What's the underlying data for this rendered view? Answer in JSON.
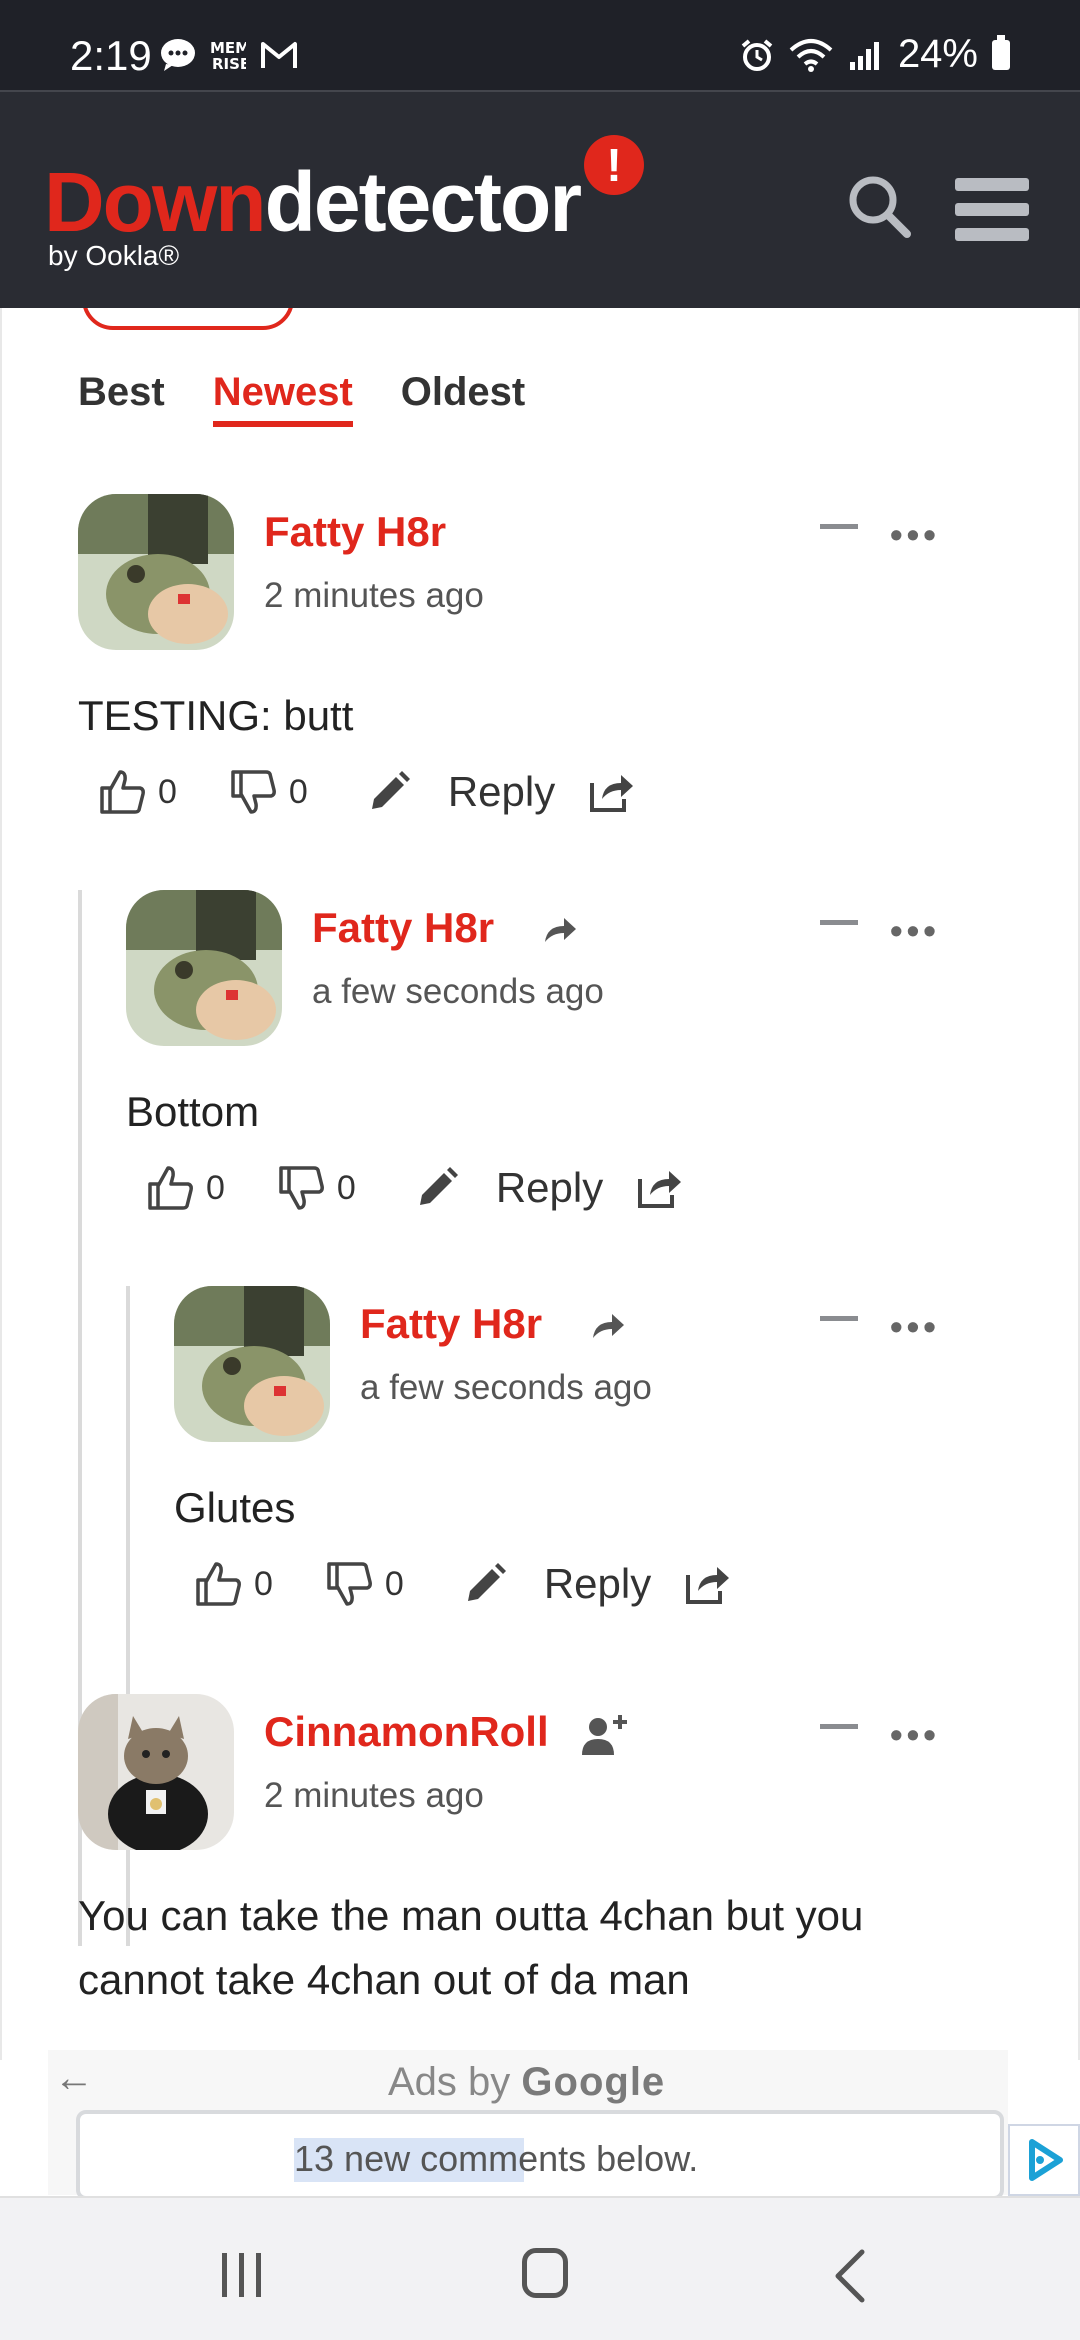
{
  "status_bar": {
    "time": "2:19",
    "left_icons": [
      "chat-icon",
      "memrise-icon",
      "gmail-icon"
    ],
    "battery": "24%",
    "right_icons": [
      "alarm-icon",
      "wifi-icon",
      "signal-icon",
      "battery-icon"
    ]
  },
  "header": {
    "logo_red": "Down",
    "logo_white": "detector",
    "logo_badge": "!",
    "byline": "by Ookla®"
  },
  "sort": {
    "tabs": [
      {
        "label": "Best",
        "active": false
      },
      {
        "label": "Newest",
        "active": true
      },
      {
        "label": "Oldest",
        "active": false
      }
    ]
  },
  "comments": [
    {
      "author": "Fatty H8r",
      "time": "2 minutes ago",
      "body": "TESTING: butt",
      "likes": "0",
      "dislikes": "0",
      "reply_label": "Reply",
      "more": "•••"
    },
    {
      "author": "Fatty H8r",
      "time": "a few seconds ago",
      "body": "Bottom",
      "likes": "0",
      "dislikes": "0",
      "reply_label": "Reply",
      "more": "•••"
    },
    {
      "author": "Fatty H8r",
      "time": "a few seconds ago",
      "body": "Glutes",
      "likes": "0",
      "dislikes": "0",
      "reply_label": "Reply",
      "more": "•••"
    },
    {
      "author": "CinnamonRoll",
      "time": "2 minutes ago",
      "body_line1": "You can take the man outta 4chan but you",
      "body_line2": "cannot take 4chan out of da man",
      "more": "•••"
    }
  ],
  "ads": {
    "label_prefix": "Ads by ",
    "label_brand": "Google",
    "new_comments": "13 new comments below."
  },
  "colors": {
    "brand_red": "#e0271c",
    "header_bg": "#2a2c33",
    "status_bg": "#1f2128"
  }
}
